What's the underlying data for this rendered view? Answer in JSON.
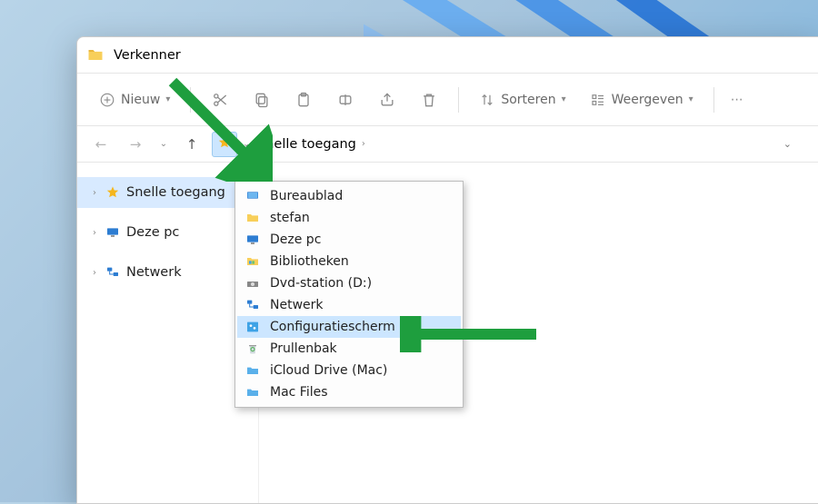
{
  "window": {
    "title": "Verkenner"
  },
  "toolbar": {
    "new_label": "Nieuw",
    "sort_label": "Sorteren",
    "view_label": "Weergeven"
  },
  "addressbar": {
    "current": "Snelle toegang"
  },
  "sidebar": {
    "items": [
      {
        "label": "Snelle toegang",
        "icon": "star",
        "active": true
      },
      {
        "label": "Deze pc",
        "icon": "monitor",
        "active": false
      },
      {
        "label": "Netwerk",
        "icon": "network",
        "active": false
      }
    ]
  },
  "dropdown": {
    "items": [
      {
        "label": "Bureaublad",
        "icon": "desktop",
        "hover": false
      },
      {
        "label": "stefan",
        "icon": "folder",
        "hover": false
      },
      {
        "label": "Deze pc",
        "icon": "monitor",
        "hover": false
      },
      {
        "label": "Bibliotheken",
        "icon": "libraries",
        "hover": false
      },
      {
        "label": "Dvd-station (D:)",
        "icon": "dvd",
        "hover": false
      },
      {
        "label": "Netwerk",
        "icon": "network",
        "hover": false
      },
      {
        "label": "Configuratiescherm",
        "icon": "control",
        "hover": true
      },
      {
        "label": "Prullenbak",
        "icon": "recycle",
        "hover": false
      },
      {
        "label": "iCloud Drive (Mac)",
        "icon": "cloudfolder",
        "hover": false
      },
      {
        "label": "Mac Files",
        "icon": "cloudfolder",
        "hover": false
      }
    ]
  }
}
